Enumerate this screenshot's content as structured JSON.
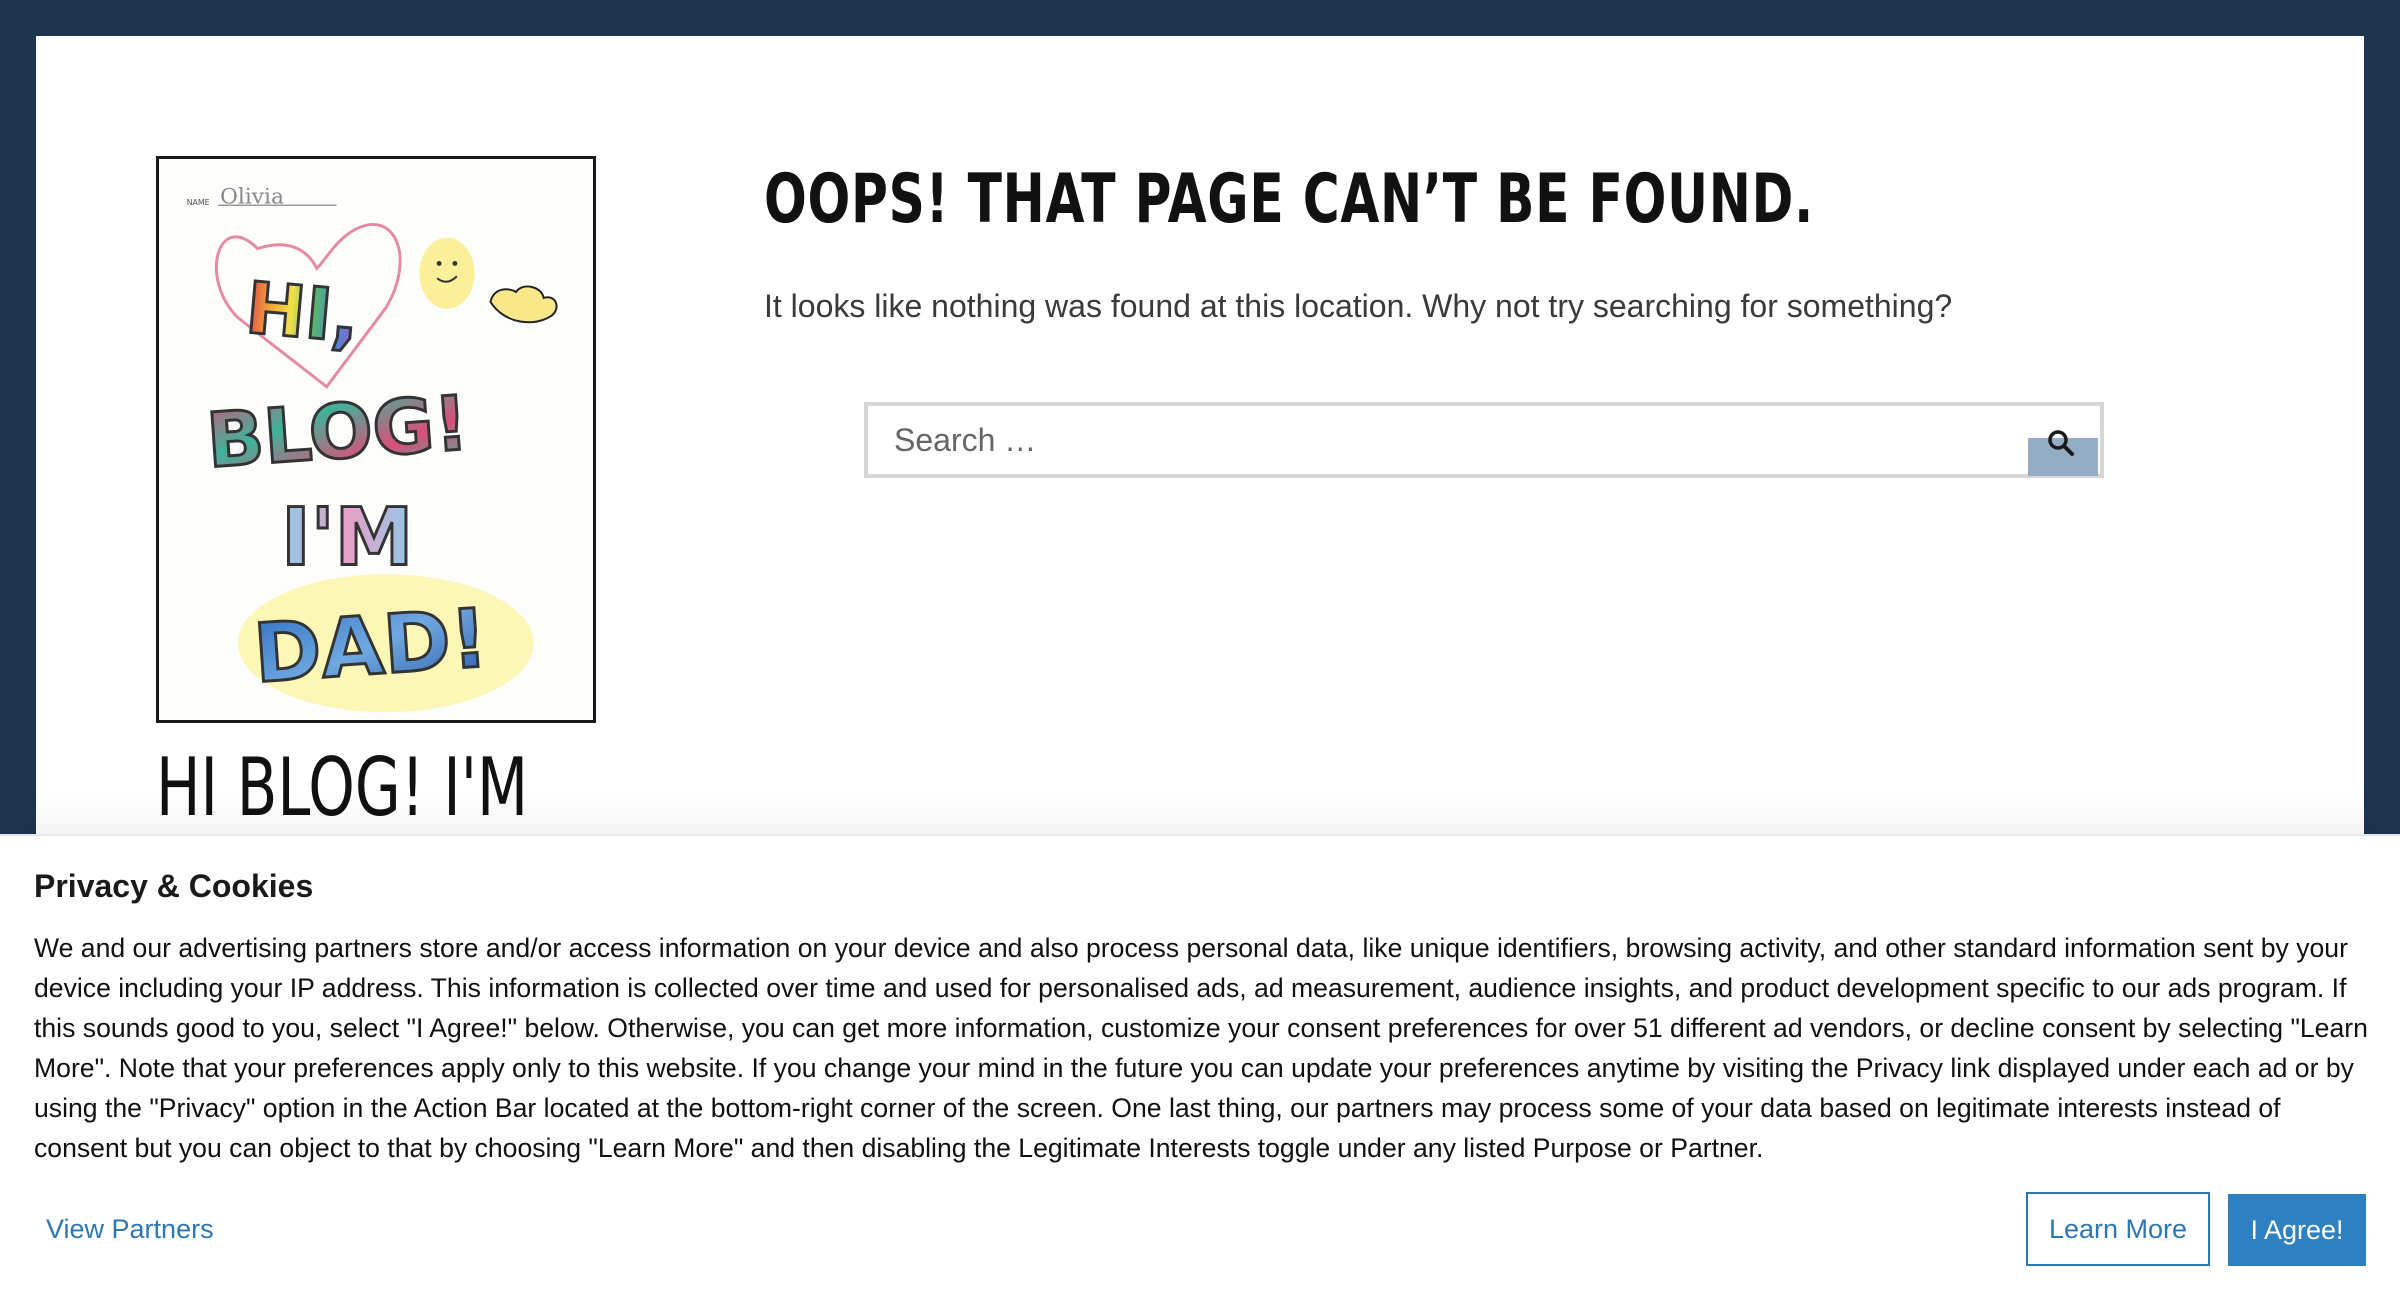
{
  "colors": {
    "frame": "#1e3550",
    "accent": "#2e80c0",
    "search_button": "#92adc4",
    "link": "#2e77b5"
  },
  "header": {
    "logo_name_label": "NAME",
    "logo_name_value": "Olivia",
    "logo_lines": [
      "HI,",
      "BLOG!",
      "I'M",
      "DAD!"
    ],
    "site_title": "HI BLOG! I'M"
  },
  "main": {
    "title": "OOPS! THAT PAGE CAN’T BE FOUND.",
    "message": "It looks like nothing was found at this location. Why not try searching for something?",
    "search": {
      "placeholder": "Search …",
      "value": "",
      "icon": "search-icon"
    }
  },
  "cookie_banner": {
    "heading": "Privacy & Cookies",
    "body": "We and our advertising partners store and/or access information on your device and also process personal data, like unique identifiers, browsing activity, and other standard information sent by your device including your IP address. This information is collected over time and used for personalised ads, ad measurement, audience insights, and product development specific to our ads program. If this sounds good to you, select \"I Agree!\" below. Otherwise, you can get more information, customize your consent preferences for over 51 different ad vendors, or decline consent by selecting \"Learn More\". Note that your preferences apply only to this website. If you change your mind in the future you can update your preferences anytime by visiting the Privacy link displayed under each ad or by using the \"Privacy\" option in the Action Bar located at the bottom-right corner of the screen. One last thing, our partners may process some of your data based on legitimate interests instead of consent but you can object to that by choosing \"Learn More\" and then disabling the Legitimate Interests toggle under any listed Purpose or Partner.",
    "view_partners_label": "View Partners",
    "learn_more_label": "Learn More",
    "agree_label": "I Agree!"
  }
}
